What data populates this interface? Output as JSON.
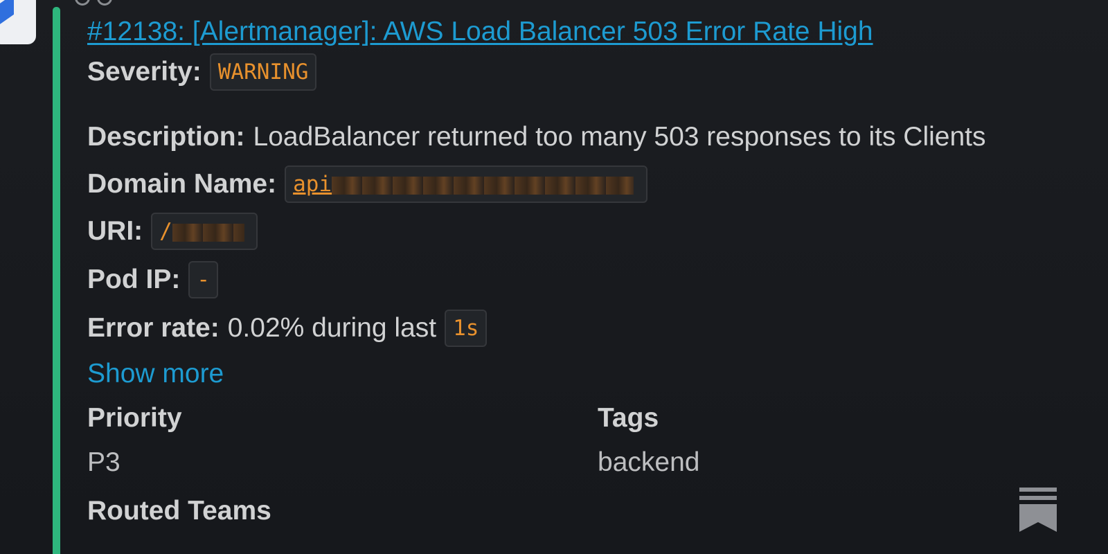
{
  "alert": {
    "title": "#12138: [Alertmanager]: AWS Load Balancer 503 Error Rate High",
    "severity_label": "Severity:",
    "severity_value": "WARNING",
    "description_label": "Description:",
    "description_value": "LoadBalancer returned too many 503 responses to its Clients",
    "domain_label": "Domain Name:",
    "domain_value": "api",
    "uri_label": "URI:",
    "uri_value": "/",
    "pod_ip_label": "Pod IP:",
    "pod_ip_value": "-",
    "error_rate_label": "Error rate:",
    "error_rate_text": "0.02% during last",
    "error_rate_window": "1s",
    "show_more": "Show more"
  },
  "fields": {
    "priority_title": "Priority",
    "priority_value": "P3",
    "tags_title": "Tags",
    "tags_value": "backend",
    "routed_title": "Routed Teams"
  },
  "icons": {
    "app": "jira-icon",
    "bookmark": "bookmark-icon"
  },
  "colors": {
    "accent": "#2eb67d",
    "link": "#1d9bd1",
    "code": "#e8912d",
    "background": "#1a1d21"
  }
}
